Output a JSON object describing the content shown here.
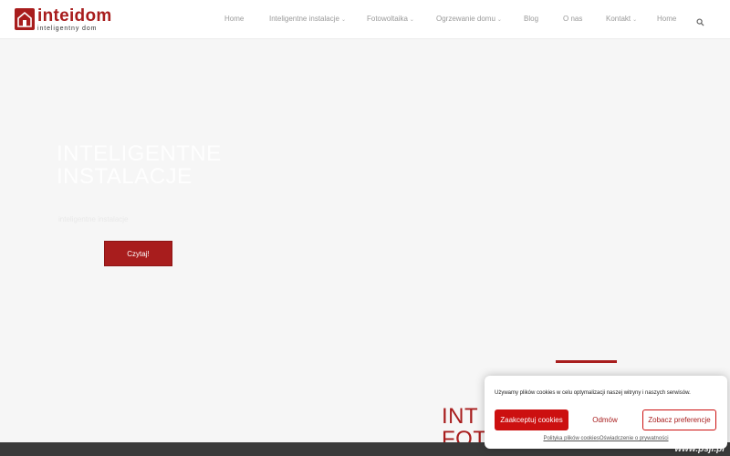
{
  "logo": {
    "name": "inteidom",
    "tagline": "inteligentny dom"
  },
  "nav": {
    "items": [
      {
        "label": "Home",
        "has_dropdown": false
      },
      {
        "label": "Inteligentne instalacje",
        "has_dropdown": true
      },
      {
        "label": "Fotowoltaika",
        "has_dropdown": true
      },
      {
        "label": "Ogrzewanie domu",
        "has_dropdown": true
      },
      {
        "label": "Blog",
        "has_dropdown": false
      },
      {
        "label": "O nas",
        "has_dropdown": false
      },
      {
        "label": "Kontakt",
        "has_dropdown": true
      },
      {
        "label": "Home",
        "has_dropdown": false
      }
    ],
    "search_icon": "search-icon"
  },
  "hero": {
    "title_line1": "INTELIGENTNE",
    "title_line2": "INSTALACJE",
    "subtitle": "inteligentne instalacje",
    "button": "Czytaj!"
  },
  "section": {
    "title_line1": "INT",
    "title_line2": "FOT"
  },
  "cookie": {
    "text": "Używamy plików cookies w celu optymalizacji naszej witryny i naszych serwisów.",
    "accept": "Zaakceptuj cookies",
    "deny": "Odmów",
    "preferences": "Zobacz preferencje",
    "link_policy": "Polityka plików cookies",
    "link_privacy": "Oświadczenie o prywatności"
  },
  "watermark": "www.psji.pl",
  "colors": {
    "brand": "#a81d1d",
    "cookie_accent": "#cc1010",
    "background": "#f6f6f6",
    "nav_text": "#9a9a9a"
  }
}
